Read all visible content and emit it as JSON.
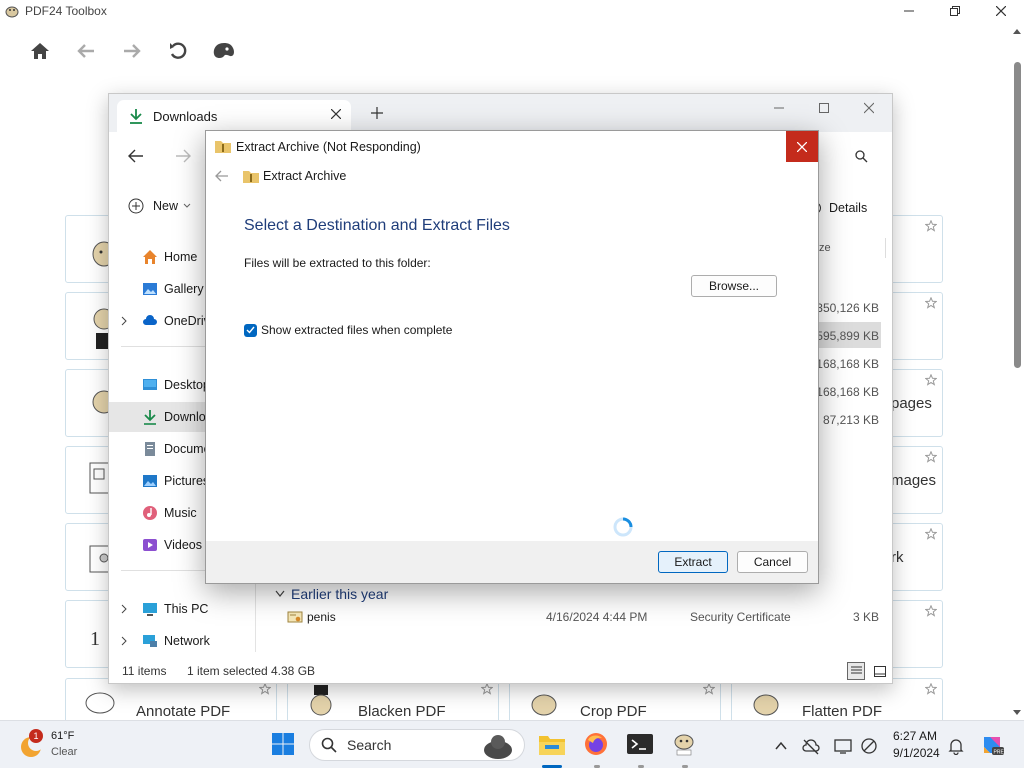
{
  "app": {
    "title": "PDF24 Toolbox",
    "toolbar": {
      "icons": [
        "home-icon",
        "back-icon",
        "forward-icon",
        "undo-icon",
        "palette-icon"
      ]
    }
  },
  "tiles": {
    "bottom_row": [
      {
        "label": "Annotate PDF"
      },
      {
        "label": "Blacken PDF"
      },
      {
        "label": "Crop PDF"
      },
      {
        "label": "Flatten PDF"
      }
    ],
    "partial_labels": [
      "pages",
      "mages",
      "rk"
    ]
  },
  "explorer": {
    "tab_title": "Downloads",
    "new_label": "New",
    "details_label": "Details",
    "size_header_partial": "ze",
    "sidebar": [
      {
        "label": "Home"
      },
      {
        "label": "Gallery"
      },
      {
        "label": "OneDriv"
      },
      {
        "label": "Desktop"
      },
      {
        "label": "Downlo"
      },
      {
        "label": "Docume"
      },
      {
        "label": "Pictures"
      },
      {
        "label": "Music"
      },
      {
        "label": "Videos"
      },
      {
        "label": "This PC"
      },
      {
        "label": "Network"
      }
    ],
    "sizes": [
      "350,126 KB",
      "595,899 KB",
      "168,168 KB",
      "168,168 KB",
      "87,213 KB"
    ],
    "group_header": "Earlier this year",
    "file_row": {
      "name": "penis",
      "date": "4/16/2024 4:44 PM",
      "type": "Security Certificate",
      "size": "3 KB"
    },
    "status": {
      "items": "11 items",
      "selected": "1 item selected",
      "size": "4.38 GB"
    }
  },
  "dialog": {
    "title": "Extract Archive (Not Responding)",
    "nav_title": "Extract Archive",
    "heading": "Select a Destination and Extract Files",
    "files_text": "Files will be extracted to this folder:",
    "browse_label": "Browse...",
    "checkbox_label": "Show extracted files when complete",
    "checkbox_checked": true,
    "extract_label": "Extract",
    "cancel_label": "Cancel"
  },
  "taskbar": {
    "weather": {
      "temp": "61°F",
      "condition": "Clear",
      "badge": "1"
    },
    "search_placeholder": "Search",
    "time": "6:27 AM",
    "date": "9/1/2024",
    "apps": [
      "file-explorer-icon",
      "firefox-icon",
      "terminal-icon",
      "pdf24-icon"
    ]
  },
  "colors": {
    "accent": "#0067c0",
    "close_red": "#c42b1c",
    "heading_blue": "#1f3d7a",
    "download_green": "#1a8a4a"
  }
}
